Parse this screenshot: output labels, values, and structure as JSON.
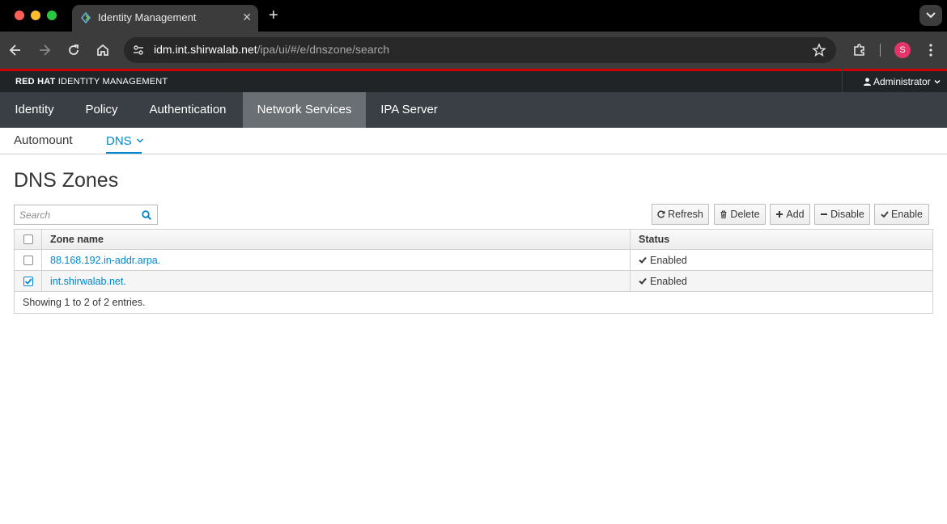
{
  "browser": {
    "tab_title": "Identity Management",
    "tab_close": "✕",
    "new_tab": "+",
    "url_host": "idm.int.shirwalab.net",
    "url_path": "/ipa/ui/#/e/dnszone/search",
    "profile_initial": "S"
  },
  "app": {
    "brand_strong": "RED HAT",
    "brand_light": " IDENTITY MANAGEMENT",
    "user_label": "Administrator",
    "accent_color": "#0088ce",
    "brand_color": "#cc0000"
  },
  "primary_nav": [
    {
      "label": "Identity",
      "active": false
    },
    {
      "label": "Policy",
      "active": false
    },
    {
      "label": "Authentication",
      "active": false
    },
    {
      "label": "Network Services",
      "active": true
    },
    {
      "label": "IPA Server",
      "active": false
    }
  ],
  "secondary_nav": [
    {
      "label": "Automount",
      "active": false
    },
    {
      "label": "DNS",
      "active": true
    }
  ],
  "page": {
    "title": "DNS Zones",
    "search_placeholder": "Search",
    "search_value": ""
  },
  "actions": {
    "refresh": "Refresh",
    "delete": "Delete",
    "add": "Add",
    "disable": "Disable",
    "enable": "Enable"
  },
  "table": {
    "columns": [
      "Zone name",
      "Status"
    ],
    "rows": [
      {
        "zone": "88.168.192.in-addr.arpa.",
        "status": "Enabled",
        "selected": false
      },
      {
        "zone": "int.shirwalab.net.",
        "status": "Enabled",
        "selected": true
      }
    ],
    "footer": "Showing 1 to 2 of 2 entries."
  },
  "icons": {
    "back": "arrow-left-icon",
    "forward": "arrow-right-icon",
    "reload": "reload-icon",
    "home": "home-icon",
    "bookmark": "star-icon",
    "extensions": "puzzle-icon",
    "menu": "kebab-icon",
    "search": "search-icon",
    "status_ok": "check-icon"
  }
}
